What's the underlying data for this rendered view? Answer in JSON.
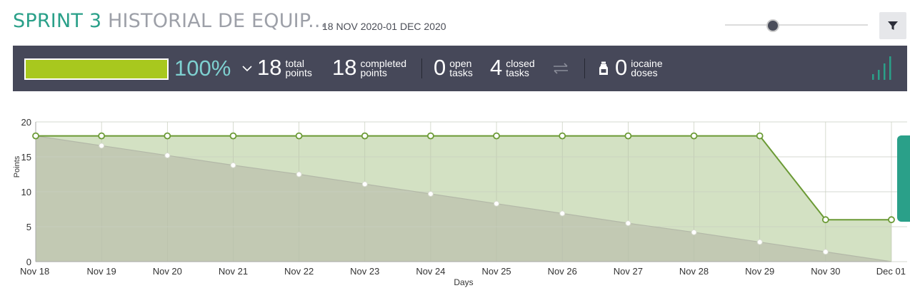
{
  "header": {
    "sprint_label": "SPRINT 3",
    "project_name": "HISTORIAL DE EQUIP...",
    "date_range": "18 NOV 2020-01 DEC 2020"
  },
  "summary": {
    "progress_fraction": 1.0,
    "progress_percent": "100%",
    "total_points": {
      "value": "18",
      "label_line1": "total",
      "label_line2": "points"
    },
    "completed_points": {
      "value": "18",
      "label_line1": "completed",
      "label_line2": "points"
    },
    "open_tasks": {
      "value": "0",
      "label_line1": "open",
      "label_line2": "tasks"
    },
    "closed_tasks": {
      "value": "4",
      "label_line1": "closed",
      "label_line2": "tasks"
    },
    "iocaine_doses": {
      "value": "0",
      "label_line1": "iocaine",
      "label_line2": "doses"
    }
  },
  "icons": [
    "filter-icon",
    "chevron-down-icon",
    "swap-arrows-icon",
    "potion-bottle-icon",
    "signal-bars-icon"
  ],
  "colors": {
    "accent": "#2aa089",
    "summary_bg": "#464859",
    "progress_fill": "#a8c81e",
    "percent_text": "#7ed0d0",
    "actual_line": "#6b9a35",
    "actual_fill": "#d3e1c3",
    "ideal_fill": "#c2c9b3"
  },
  "chart_data": {
    "type": "line",
    "xlabel": "Days",
    "ylabel": "Points",
    "categories": [
      "Nov 18",
      "Nov 19",
      "Nov 20",
      "Nov 21",
      "Nov 22",
      "Nov 23",
      "Nov 24",
      "Nov 25",
      "Nov 26",
      "Nov 27",
      "Nov 28",
      "Nov 29",
      "Nov 30",
      "Dec 01"
    ],
    "ylim": [
      0,
      20
    ],
    "yticks": [
      0,
      5,
      10,
      15,
      20
    ],
    "grid": true,
    "series": [
      {
        "values": [
          18,
          18,
          18,
          18,
          18,
          18,
          18,
          18,
          18,
          18,
          18,
          18,
          6,
          6
        ]
      },
      {
        "values": [
          18,
          16.6,
          15.2,
          13.8,
          12.5,
          11.1,
          9.7,
          8.3,
          6.9,
          5.5,
          4.2,
          2.8,
          1.4,
          0
        ]
      }
    ]
  }
}
